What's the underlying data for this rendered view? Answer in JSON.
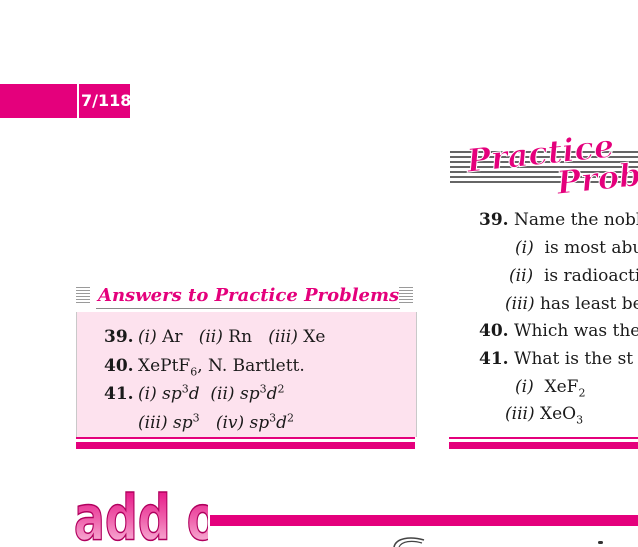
{
  "page": {
    "number": "7/118"
  },
  "answers": {
    "title": "Answers to Practice Problems",
    "items": [
      {
        "num": "39.",
        "parts": [
          {
            "label": "(i)",
            "text": "Ar"
          },
          {
            "label": "(ii)",
            "text": "Rn"
          },
          {
            "label": "(iii)",
            "text": "Xe"
          }
        ]
      },
      {
        "num": "40.",
        "formula_main": "XePtF",
        "formula_sub": "6",
        "text_after": ", N. Bartlett."
      },
      {
        "num": "41.",
        "row1": [
          {
            "label": "(i)",
            "base": "sp",
            "sup1": "3",
            "tail": "d",
            "sup2": ""
          },
          {
            "label": "(ii)",
            "base": "sp",
            "sup1": "3",
            "tail": "d",
            "sup2": "2"
          }
        ],
        "row2": [
          {
            "label": "(iii)",
            "base": "sp",
            "sup1": "3"
          },
          {
            "label": "(iv)",
            "base": "sp",
            "sup1": "3",
            "tail": "d",
            "sup2": "2"
          }
        ]
      }
    ]
  },
  "practice": {
    "logo_word1": "Practice",
    "logo_word2": "Prob",
    "q39": {
      "num": "39.",
      "text": "Name the nobl"
    },
    "q39_i": {
      "label": "(i)",
      "text": "is most abu"
    },
    "q39_ii": {
      "label": "(ii)",
      "text": "is radioacti"
    },
    "q39_iii": {
      "label": "(iii)",
      "text": "has least be"
    },
    "q40": {
      "num": "40.",
      "text": "Which was the"
    },
    "q41": {
      "num": "41.",
      "text": "What is the st"
    },
    "q41_i": {
      "label": "(i)",
      "main": "XeF",
      "sub": "2"
    },
    "q41_iii": {
      "label": "(iii)",
      "main": "XeO",
      "sub": "3"
    }
  },
  "addon": {
    "logo_text": "add on"
  },
  "colors": {
    "accent": "#e4007c",
    "answers_bg": "#fde2ee"
  }
}
